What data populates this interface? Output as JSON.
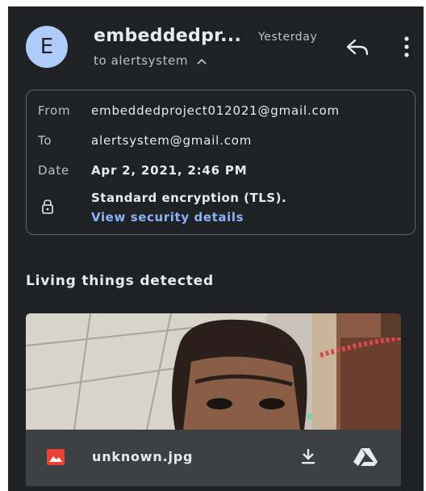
{
  "header": {
    "avatar_letter": "E",
    "sender": "embeddedpr...",
    "time": "Yesterday",
    "recipients": "to alertsystem"
  },
  "details": {
    "from_label": "From",
    "from_value": "embeddedproject012021@gmail.com",
    "to_label": "To",
    "to_value": "alertsystem@gmail.com",
    "date_label": "Date",
    "date_value": "Apr 2, 2021, 2:46 PM",
    "encryption": "Standard encryption (TLS).",
    "security_link": "View security details"
  },
  "body": {
    "text": "Living things detected"
  },
  "attachment": {
    "filename": "unknown.jpg"
  },
  "icons": [
    "reply-icon",
    "more-vert-icon",
    "chevron-up-icon",
    "lock-icon",
    "image-file-icon",
    "download-icon",
    "drive-icon"
  ],
  "colors": {
    "background": "#202124",
    "avatar": "#aecbfa",
    "link": "#8ab4f8",
    "image_icon": "#ea4335"
  }
}
